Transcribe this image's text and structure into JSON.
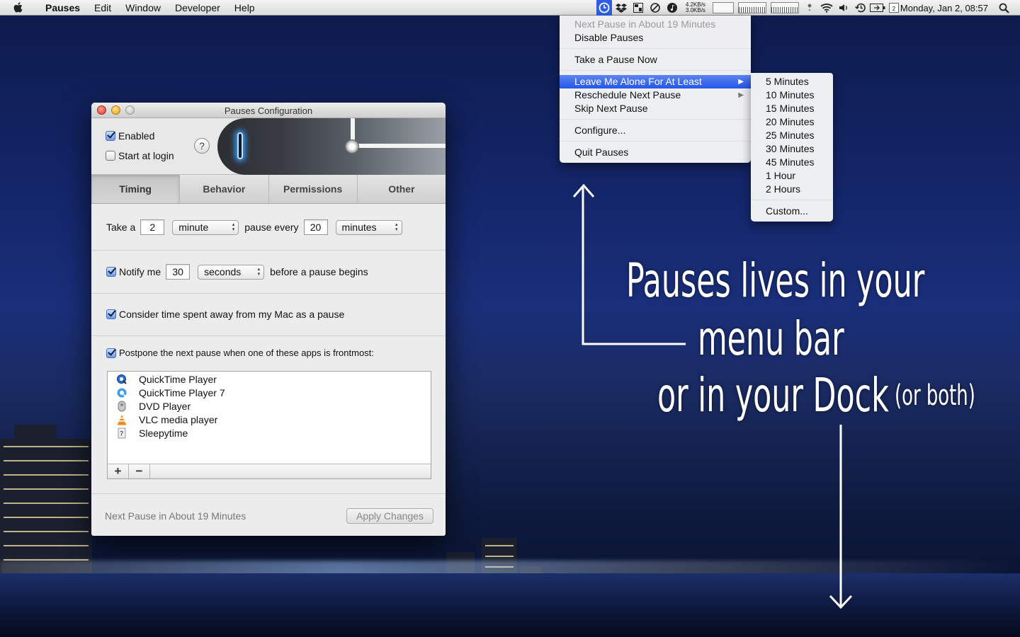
{
  "menubar": {
    "app_name": "Pauses",
    "menus": [
      "Edit",
      "Window",
      "Developer",
      "Help"
    ],
    "netspeed_up": "4.2KB/s",
    "netspeed_down": "3.0KB/s",
    "calendar_day": "2",
    "clock": "Monday, Jan 2, 08:57"
  },
  "status_menu": {
    "items": [
      {
        "label": "Next Pause in About 19 Minutes",
        "disabled": true
      },
      {
        "label": "Disable Pauses"
      },
      {
        "label": "Take a Pause Now"
      },
      {
        "label": "Leave Me Alone For At Least",
        "submenu": true,
        "highlighted": true
      },
      {
        "label": "Reschedule Next Pause",
        "submenu": true
      },
      {
        "label": "Skip Next Pause"
      },
      {
        "label": "Configure..."
      },
      {
        "label": "Quit Pauses"
      }
    ]
  },
  "submenu": {
    "items": [
      "5 Minutes",
      "10 Minutes",
      "15 Minutes",
      "20 Minutes",
      "25 Minutes",
      "30 Minutes",
      "45 Minutes",
      "1 Hour",
      "2 Hours",
      "Custom..."
    ]
  },
  "window": {
    "title": "Pauses Configuration",
    "enabled_label": "Enabled",
    "enabled_checked": true,
    "start_login_label": "Start at login",
    "start_login_checked": false,
    "help_label": "?",
    "tabs": [
      "Timing",
      "Behavior",
      "Permissions",
      "Other"
    ],
    "selected_tab": "Timing",
    "timing": {
      "take_a": "Take a",
      "duration_value": "2",
      "duration_unit": "minute",
      "pause_every": "pause every",
      "interval_value": "20",
      "interval_unit": "minutes"
    },
    "notify": {
      "label": "Notify me",
      "checked": true,
      "value": "30",
      "unit": "seconds",
      "suffix": "before a pause begins"
    },
    "away": {
      "label": "Consider time spent away from my Mac as a pause",
      "checked": true
    },
    "postpone": {
      "label": "Postpone the next pause when one of these apps is frontmost:",
      "checked": true
    },
    "apps": [
      "QuickTime Player",
      "QuickTime Player 7",
      "DVD Player",
      "VLC media player",
      "Sleepytime"
    ],
    "add_label": "+",
    "remove_label": "−",
    "footer_status": "Next Pause in About 19 Minutes",
    "apply_label": "Apply Changes"
  },
  "annotations": {
    "line1": "Pauses lives in your",
    "line2": "menu bar",
    "line3": "or in your Dock",
    "line3_small": "(or both)"
  },
  "colors": {
    "highlight": "#2456e8",
    "desktop": "#14266a"
  }
}
